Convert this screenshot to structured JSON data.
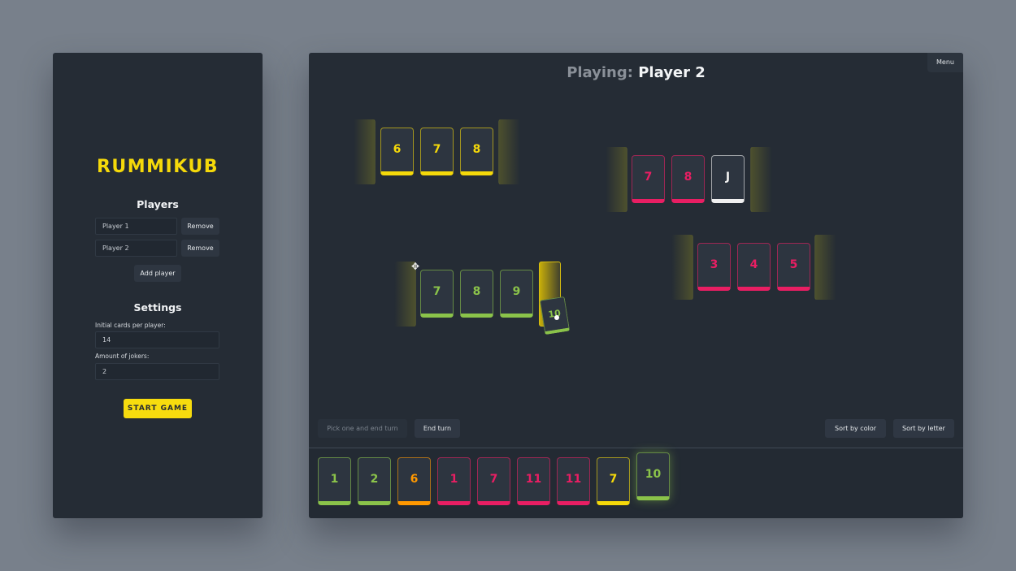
{
  "colors": {
    "yellow": "#f5d90a",
    "green": "#8bc34a",
    "red": "#e91e63",
    "orange": "#ff9800",
    "white": "#f0f0f0"
  },
  "setup": {
    "logo": "RUMMIKUB",
    "players_title": "Players",
    "players": [
      {
        "name": "Player 1",
        "remove_label": "Remove"
      },
      {
        "name": "Player 2",
        "remove_label": "Remove"
      }
    ],
    "add_player_label": "Add player",
    "settings_title": "Settings",
    "initial_cards_label": "Initial cards per player:",
    "initial_cards_value": "14",
    "jokers_label": "Amount of jokers:",
    "jokers_value": "2",
    "start_label": "START GAME"
  },
  "game": {
    "playing_label": "Playing:",
    "current_player": "Player 2",
    "menu_label": "Menu",
    "board_groups": [
      {
        "tiles": [
          {
            "value": "6",
            "color": "yellow"
          },
          {
            "value": "7",
            "color": "yellow"
          },
          {
            "value": "8",
            "color": "yellow"
          }
        ]
      },
      {
        "tiles": [
          {
            "value": "7",
            "color": "red"
          },
          {
            "value": "8",
            "color": "red"
          },
          {
            "value": "J",
            "color": "white"
          }
        ]
      },
      {
        "tiles": [
          {
            "value": "7",
            "color": "green"
          },
          {
            "value": "8",
            "color": "green"
          },
          {
            "value": "9",
            "color": "green"
          }
        ]
      },
      {
        "tiles": [
          {
            "value": "3",
            "color": "red"
          },
          {
            "value": "4",
            "color": "red"
          },
          {
            "value": "5",
            "color": "red"
          }
        ]
      }
    ],
    "dragging_tile": {
      "value": "10",
      "color": "green"
    },
    "pick_label": "Pick one and end turn",
    "end_turn_label": "End turn",
    "sort_color_label": "Sort by color",
    "sort_letter_label": "Sort by letter",
    "rack": [
      {
        "value": "1",
        "color": "green"
      },
      {
        "value": "2",
        "color": "green"
      },
      {
        "value": "6",
        "color": "orange"
      },
      {
        "value": "1",
        "color": "red"
      },
      {
        "value": "7",
        "color": "red"
      },
      {
        "value": "11",
        "color": "red"
      },
      {
        "value": "11",
        "color": "red"
      },
      {
        "value": "7",
        "color": "yellow"
      },
      {
        "value": "10",
        "color": "green",
        "lifted": true
      }
    ]
  }
}
